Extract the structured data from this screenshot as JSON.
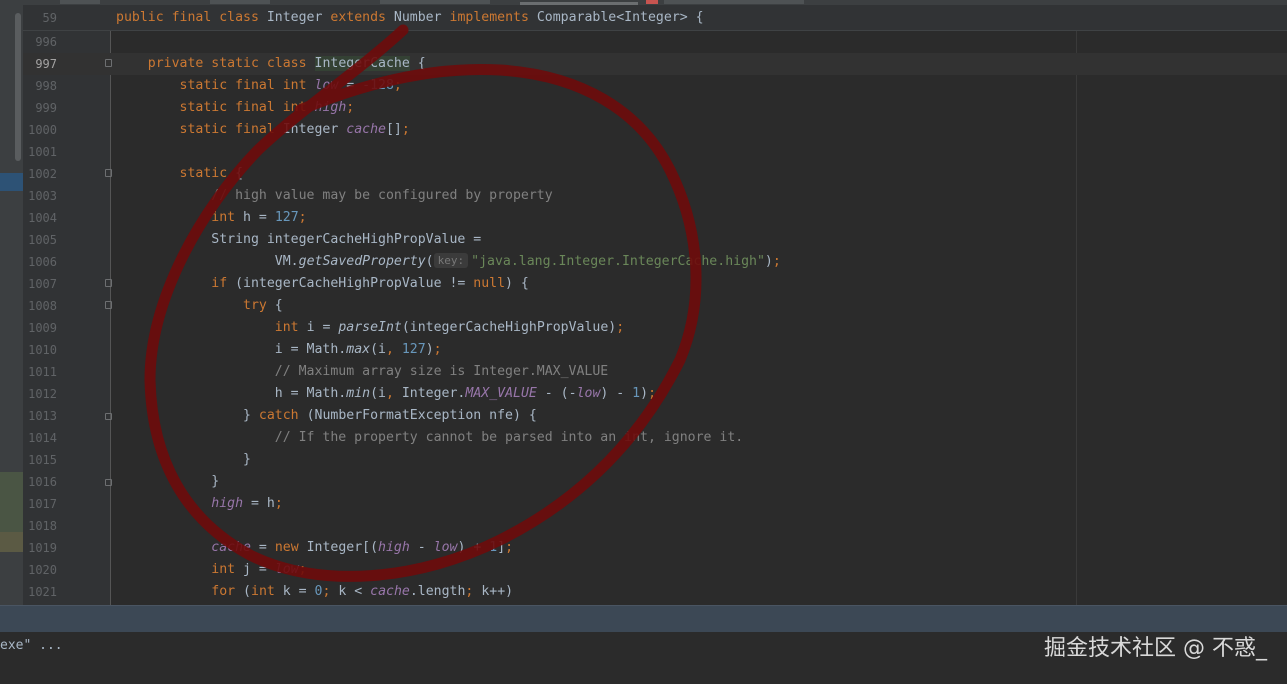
{
  "editor": {
    "sticky": {
      "line_number": "59",
      "code": [
        {
          "t": "public final class ",
          "c": "kw"
        },
        {
          "t": "Integer "
        },
        {
          "t": "extends ",
          "c": "kw"
        },
        {
          "t": "Number "
        },
        {
          "t": "implements ",
          "c": "kw"
        },
        {
          "t": "Comparable<Integer> {"
        }
      ]
    },
    "lines": [
      {
        "n": "996",
        "code": []
      },
      {
        "n": "997",
        "current": true,
        "fold": "start",
        "code": [
          {
            "t": "    private static class ",
            "c": "kw"
          },
          {
            "t": "IntegerCache",
            "c": "hl-cls"
          },
          {
            "t": " {"
          }
        ]
      },
      {
        "n": "998",
        "code": [
          {
            "t": "        static final int ",
            "c": "kw"
          },
          {
            "t": "low",
            "c": "fld"
          },
          {
            "t": " = "
          },
          {
            "t": "-128",
            "c": "num"
          },
          {
            "t": ";",
            "c": "kw"
          }
        ]
      },
      {
        "n": "999",
        "code": [
          {
            "t": "        static final int ",
            "c": "kw"
          },
          {
            "t": "high",
            "c": "fld"
          },
          {
            "t": ";",
            "c": "kw"
          }
        ]
      },
      {
        "n": "1000",
        "code": [
          {
            "t": "        static final ",
            "c": "kw"
          },
          {
            "t": "Integer "
          },
          {
            "t": "cache",
            "c": "fld"
          },
          {
            "t": "[]"
          },
          {
            "t": ";",
            "c": "kw"
          }
        ]
      },
      {
        "n": "1001",
        "code": []
      },
      {
        "n": "1002",
        "fold": "start",
        "code": [
          {
            "t": "        static ",
            "c": "kw"
          },
          {
            "t": "{"
          }
        ]
      },
      {
        "n": "1003",
        "code": [
          {
            "t": "            // high value may be configured by property",
            "c": "cmt"
          }
        ]
      },
      {
        "n": "1004",
        "code": [
          {
            "t": "            int ",
            "c": "kw"
          },
          {
            "t": "h = "
          },
          {
            "t": "127",
            "c": "num"
          },
          {
            "t": ";",
            "c": "kw"
          }
        ]
      },
      {
        "n": "1005",
        "code": [
          {
            "t": "            String integerCacheHighPropValue ="
          }
        ]
      },
      {
        "n": "1006",
        "code": [
          {
            "t": "                    VM."
          },
          {
            "t": "getSavedProperty",
            "c": "smth"
          },
          {
            "t": "("
          },
          {
            "t": "key:",
            "c": "hint"
          },
          {
            "t": "\"java.lang.Integer.IntegerCache.high\"",
            "c": "str"
          },
          {
            "t": ")"
          },
          {
            "t": ";",
            "c": "kw"
          }
        ]
      },
      {
        "n": "1007",
        "fold": "start",
        "code": [
          {
            "t": "            if ",
            "c": "kw"
          },
          {
            "t": "(integerCacheHighPropValue != "
          },
          {
            "t": "null",
            "c": "kw"
          },
          {
            "t": ") {"
          }
        ]
      },
      {
        "n": "1008",
        "fold": "start",
        "code": [
          {
            "t": "                try ",
            "c": "kw"
          },
          {
            "t": "{"
          }
        ]
      },
      {
        "n": "1009",
        "code": [
          {
            "t": "                    int ",
            "c": "kw"
          },
          {
            "t": "i = "
          },
          {
            "t": "parseInt",
            "c": "smth"
          },
          {
            "t": "(integerCacheHighPropValue)"
          },
          {
            "t": ";",
            "c": "kw"
          }
        ]
      },
      {
        "n": "1010",
        "code": [
          {
            "t": "                    i = Math."
          },
          {
            "t": "max",
            "c": "smth"
          },
          {
            "t": "(i"
          },
          {
            "t": ", ",
            "c": "kw"
          },
          {
            "t": "127",
            "c": "num"
          },
          {
            "t": ")"
          },
          {
            "t": ";",
            "c": "kw"
          }
        ]
      },
      {
        "n": "1011",
        "code": [
          {
            "t": "                    // Maximum array size is Integer.MAX_VALUE",
            "c": "cmt"
          }
        ]
      },
      {
        "n": "1012",
        "code": [
          {
            "t": "                    h = Math."
          },
          {
            "t": "min",
            "c": "smth"
          },
          {
            "t": "(i"
          },
          {
            "t": ", ",
            "c": "kw"
          },
          {
            "t": "Integer."
          },
          {
            "t": "MAX_VALUE",
            "c": "sfld"
          },
          {
            "t": " - (-"
          },
          {
            "t": "low",
            "c": "fld"
          },
          {
            "t": ") - "
          },
          {
            "t": "1",
            "c": "num"
          },
          {
            "t": ")"
          },
          {
            "t": ";",
            "c": "kw"
          }
        ]
      },
      {
        "n": "1013",
        "fold": "end",
        "code": [
          {
            "t": "                } "
          },
          {
            "t": "catch ",
            "c": "kw"
          },
          {
            "t": "(NumberFormatException nfe) {"
          }
        ]
      },
      {
        "n": "1014",
        "code": [
          {
            "t": "                    // If the property cannot be parsed into an int, ignore it.",
            "c": "cmt"
          }
        ]
      },
      {
        "n": "1015",
        "code": [
          {
            "t": "                }"
          }
        ]
      },
      {
        "n": "1016",
        "fold": "end",
        "code": [
          {
            "t": "            }"
          }
        ]
      },
      {
        "n": "1017",
        "code": [
          {
            "t": "            "
          },
          {
            "t": "high",
            "c": "fld"
          },
          {
            "t": " = h"
          },
          {
            "t": ";",
            "c": "kw"
          }
        ]
      },
      {
        "n": "1018",
        "code": []
      },
      {
        "n": "1019",
        "code": [
          {
            "t": "            "
          },
          {
            "t": "cache",
            "c": "fld"
          },
          {
            "t": " = "
          },
          {
            "t": "new ",
            "c": "kw"
          },
          {
            "t": "Integer[("
          },
          {
            "t": "high",
            "c": "fld"
          },
          {
            "t": " - "
          },
          {
            "t": "low",
            "c": "fld"
          },
          {
            "t": ") + "
          },
          {
            "t": "1",
            "c": "num"
          },
          {
            "t": "]"
          },
          {
            "t": ";",
            "c": "kw"
          }
        ]
      },
      {
        "n": "1020",
        "code": [
          {
            "t": "            int ",
            "c": "kw"
          },
          {
            "t": "j = "
          },
          {
            "t": "low",
            "c": "fld"
          },
          {
            "t": ";",
            "c": "kw"
          }
        ]
      },
      {
        "n": "1021",
        "code": [
          {
            "t": "            for ",
            "c": "kw"
          },
          {
            "t": "("
          },
          {
            "t": "int ",
            "c": "kw"
          },
          {
            "t": "k = "
          },
          {
            "t": "0",
            "c": "num"
          },
          {
            "t": "; ",
            "c": "kw"
          },
          {
            "t": "k < "
          },
          {
            "t": "cache",
            "c": "fld"
          },
          {
            "t": ".length"
          },
          {
            "t": "; ",
            "c": "kw"
          },
          {
            "t": "k++)"
          }
        ]
      }
    ]
  },
  "console": {
    "text": "exe\" ..."
  },
  "watermark": {
    "text": "掘金技术社区 @ 不惑_"
  },
  "colors": {
    "background": "#2b2b2b",
    "gutter": "#313335",
    "keyword": "#cc7832",
    "number": "#6897bb",
    "string": "#6a8759",
    "comment": "#808080",
    "field": "#9876aa",
    "annotation_ink": "#7a0d0d"
  }
}
